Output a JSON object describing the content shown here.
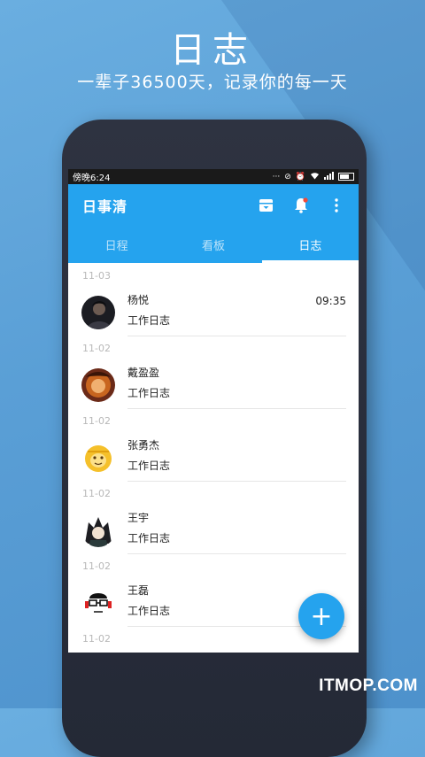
{
  "promo": {
    "title": "日志",
    "subtitle": "一辈子36500天，记录你的每一天"
  },
  "status_bar": {
    "time": "傍晚6:24",
    "icons": [
      "more-dots-icon",
      "alarm-off-icon",
      "alarm-icon",
      "wifi-icon",
      "signal-icon",
      "battery-icon"
    ],
    "dots": "···"
  },
  "app_bar": {
    "title": "日事清",
    "actions": [
      "archive-icon",
      "bell-icon",
      "more-vert-icon"
    ]
  },
  "tabs": [
    {
      "label": "日程",
      "active": false
    },
    {
      "label": "看板",
      "active": false
    },
    {
      "label": "日志",
      "active": true
    }
  ],
  "entries": [
    {
      "date": "11-03",
      "name": "杨悦",
      "subtitle": "工作日志",
      "time": "09:35",
      "avatar": "avatar-dark"
    },
    {
      "date": "11-02",
      "name": "戴盈盈",
      "subtitle": "工作日志",
      "time": "",
      "avatar": "avatar-warm"
    },
    {
      "date": "11-02",
      "name": "张勇杰",
      "subtitle": "工作日志",
      "time": "",
      "avatar": "avatar-monkey"
    },
    {
      "date": "11-02",
      "name": "王宇",
      "subtitle": "工作日志",
      "time": "",
      "avatar": "avatar-anime"
    },
    {
      "date": "11-02",
      "name": "王磊",
      "subtitle": "工作日志",
      "time": "",
      "avatar": "avatar-glasses"
    },
    {
      "date": "11-02",
      "name": "",
      "subtitle": "",
      "time": "",
      "avatar": ""
    }
  ],
  "fab": {
    "label": "+"
  },
  "watermark": "ITMOP.COM",
  "colors": {
    "accent": "#25a3ee",
    "background": "#5a9fd6",
    "phone_body": "#2a2f3c"
  }
}
